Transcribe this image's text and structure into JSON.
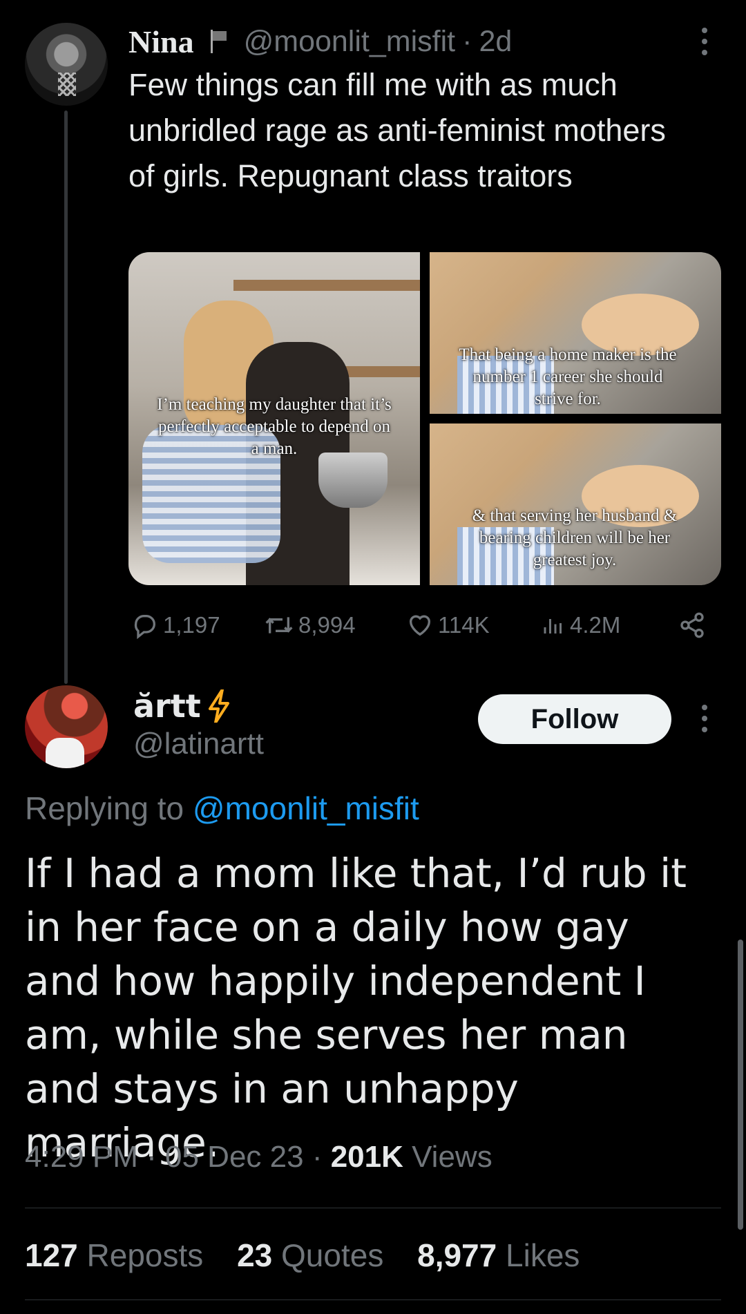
{
  "tweet": {
    "author_name": "Nina",
    "author_handle": "@moonlit_misfit",
    "separator": "·",
    "time": "2d",
    "text": "Few things can fill me with as much unbridled rage as anti-feminist mothers of girls. Repugnant class traitors",
    "media_captions": [
      "I’m teaching my daughter that it’s perfectly acceptable to depend on a man.",
      "That being a home maker is the number 1 career she should strive for.",
      "& that serving her husband & bearing children will be her greatest joy."
    ],
    "actions": {
      "replies": "1,197",
      "reposts": "8,994",
      "likes": "114K",
      "views": "4.2M"
    },
    "icons": [
      "flag-icon",
      "more-icon",
      "reply-icon",
      "repost-icon",
      "like-icon",
      "views-icon",
      "share-icon"
    ]
  },
  "reply": {
    "author_name": "ărtt",
    "author_handle": "@latinartt",
    "follow_label": "Follow",
    "replying_prefix": "Replying to",
    "replying_to": "@moonlit_misfit",
    "text": "If I had a mom like that, I’d rub it in her face on a daily how gay and how happily independent I am, while she serves her man and stays in an unhappy marriage.",
    "time": "4:29 PM",
    "date": "05 Dec 23",
    "separator": "·",
    "views_count": "201K",
    "views_label": "Views",
    "stats": [
      {
        "count": "127",
        "label": "Reposts"
      },
      {
        "count": "23",
        "label": "Quotes"
      },
      {
        "count": "8,977",
        "label": "Likes"
      }
    ],
    "icons": [
      "lightning-icon",
      "more-icon"
    ]
  },
  "colors": {
    "background": "#000000",
    "text": "#e7e9ea",
    "secondary": "#71767b",
    "link": "#1d9bf0",
    "bolt": "#ffad1f"
  }
}
